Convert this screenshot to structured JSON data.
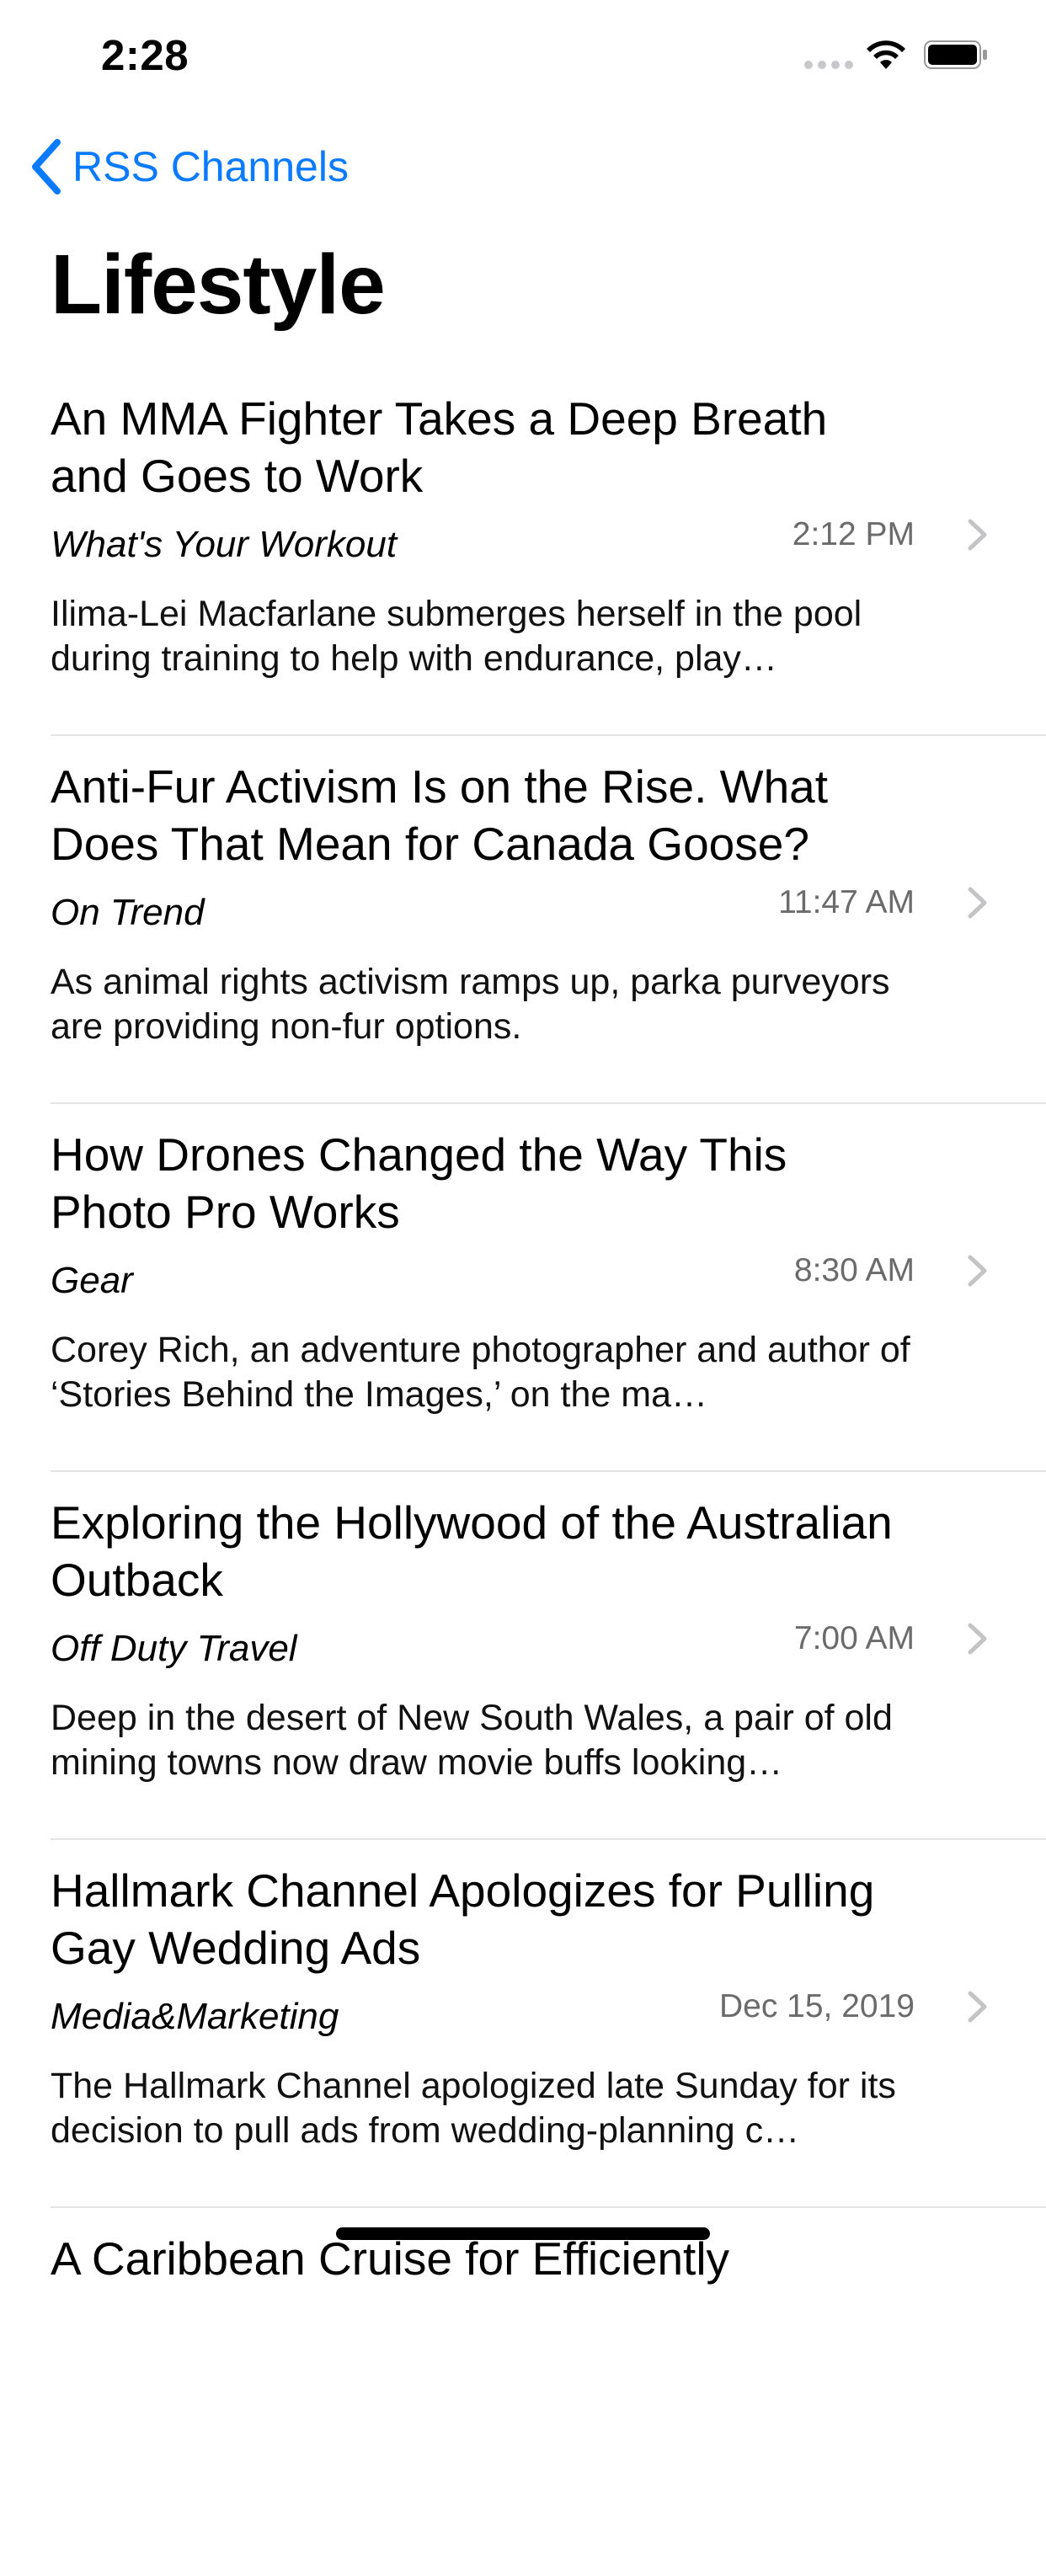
{
  "status_bar": {
    "time": "2:28"
  },
  "nav": {
    "back_label": "RSS Channels",
    "title": "Lifestyle"
  },
  "items": [
    {
      "title": "An MMA Fighter Takes a Deep Breath and Goes to Work",
      "category": "What's Your Workout",
      "time": "2:12 PM",
      "description": "Ilima-Lei Macfarlane submerges herself in the pool during training to help with endurance, play…"
    },
    {
      "title": "Anti-Fur Activism Is on the Rise. What Does That Mean for Canada Goose?",
      "category": "On Trend",
      "time": "11:47 AM",
      "description": "As animal rights activism ramps up, parka purveyors are providing non-fur options."
    },
    {
      "title": "How Drones Changed the Way This Photo Pro Works",
      "category": "Gear",
      "time": "8:30 AM",
      "description": "Corey Rich, an adventure photographer and author of ‘Stories Behind the Images,’ on the ma…"
    },
    {
      "title": "Exploring the Hollywood of the Australian Outback",
      "category": "Off Duty Travel",
      "time": "7:00 AM",
      "description": "Deep in the desert of New South Wales, a pair of old mining towns now draw movie buffs looking…"
    },
    {
      "title": "Hallmark Channel Apologizes for Pulling Gay Wedding Ads",
      "category": "Media&Marketing",
      "time": "Dec 15, 2019",
      "description": "The Hallmark Channel apologized late Sunday for its decision to pull ads from wedding-planning c…"
    },
    {
      "title": "A Caribbean Cruise for Efficiently",
      "category": "",
      "time": "",
      "description": ""
    }
  ],
  "colors": {
    "accent": "#0a7aff",
    "secondary_text": "#6b6b6b",
    "separator": "#e3e3e6"
  },
  "icons": {
    "back": "chevron-left-icon",
    "row": "chevron-right-icon",
    "wifi": "wifi-icon",
    "battery": "battery-icon",
    "signal": "cellular-signal-icon"
  }
}
